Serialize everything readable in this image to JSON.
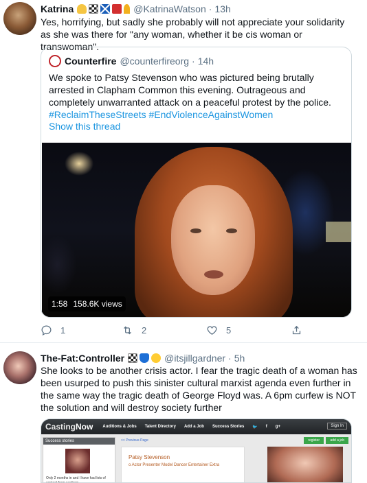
{
  "tweet1": {
    "name": "Katrina",
    "handle": "@KatrinaWatson",
    "dot": "·",
    "time": "13h",
    "text": "Yes, horrifying, but sadly she probably will not appreciate your solidarity as she was there for \"any woman, whether it be cis woman or transwoman\".",
    "badges": [
      "victory-hand-icon",
      "chequered-flag-icon",
      "scotland-flag-icon",
      "red-square-icon",
      "ribbon-icon"
    ],
    "quote": {
      "name": "Counterfire",
      "handle": "@counterfireorg",
      "dot": "·",
      "time": "14h",
      "text_plain": "We spoke to Patsy Stevenson who was pictured being brutally arrested in Clapham Common this evening. Outrageous and completely unwarranted attack on a peaceful protest by the police. ",
      "hashtag1": "#ReclaimTheseStreets",
      "hashtag2": "#EndViolenceAgainstWomen",
      "show_thread": "Show this thread",
      "video": {
        "duration": "1:58",
        "views": "158.6K views"
      }
    },
    "actions": {
      "reply_count": "1",
      "retweet_count": "2",
      "like_count": "5"
    }
  },
  "tweet2": {
    "name": "The-Fat:Controller",
    "handle": "@itsjillgardner",
    "dot": "·",
    "time": "5h",
    "badges": [
      "chequered-flag-icon",
      "shield-heart-icon",
      "smiling-face-icon"
    ],
    "text": "She looks to be another crisis actor. I fear the tragic death of a woman has been usurped to push this sinister cultural marxist agenda even further in the same way the tragic death of George Floyd was.  A 6pm curfew is NOT the solution and will destroy society further",
    "image": {
      "site_logo_a": "Casting",
      "site_logo_b": "Now",
      "nav": [
        "Auditions & Jobs",
        "Talent Directory",
        "Add a Job",
        "Success Stories"
      ],
      "social": [
        "twitter",
        "facebook",
        "google-plus"
      ],
      "signin": "Sign In",
      "success_title": "Success stories",
      "previous_page": "<< Previous Page",
      "register": "register",
      "add_job": "add a job",
      "profile_name": "Patsy Stevenson",
      "profile_roles": "o Actor Presenter Model Dancer Entertainer Extra",
      "testimonial": "Only 2 months in and I have had lots of contact from castings"
    }
  },
  "colors": {
    "link": "#1b95e0",
    "muted": "#5b7083",
    "text": "#0f1419",
    "border": "#cfd9de"
  }
}
